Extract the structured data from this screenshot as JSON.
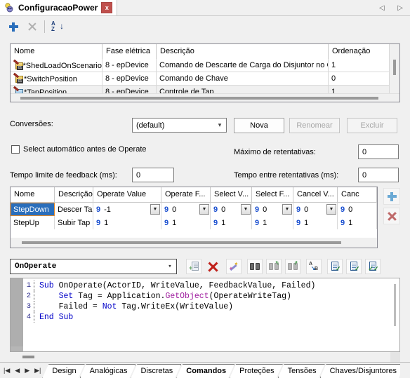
{
  "window": {
    "tab_title": "ConfiguracaoPower",
    "close_label": "x",
    "nav_prev": "◁",
    "nav_next": "▷"
  },
  "toolbar": {
    "add_label": "+",
    "delete_label": "×",
    "sort_a": "A",
    "sort_z": "Z",
    "sort_arrow": "↓"
  },
  "top_grid": {
    "columns": [
      "Nome",
      "Fase elétrica",
      "Descrição",
      "Ordenação"
    ],
    "rows": [
      {
        "icon": "tag-yellow-icon",
        "nome": "*ShedLoadOnScenario",
        "fase": "8 - epDevice",
        "descricao": "Comando de Descarte de Carga do Disjuntor no Ce",
        "ordenacao": "1"
      },
      {
        "icon": "tag-yellow-icon",
        "nome": "*SwitchPosition",
        "fase": "8 - epDevice",
        "descricao": "Comando de Chave",
        "ordenacao": "0"
      },
      {
        "icon": "tag-blue-icon",
        "nome": "*TapPosition",
        "fase": "8 - epDevice",
        "descricao": "Controle de Tap",
        "ordenacao": "1"
      }
    ]
  },
  "conversions": {
    "label": "Conversões:",
    "selected": "(default)",
    "new_button": "Nova",
    "rename_button": "Renomear",
    "delete_button": "Excluir"
  },
  "options": {
    "auto_select_label": "Select automático antes de Operate",
    "auto_select_checked": false,
    "feedback_timeout_label": "Tempo limite de feedback (ms):",
    "feedback_timeout_value": "0",
    "max_retries_label": "Máximo de retentativas:",
    "max_retries_value": "0",
    "retry_interval_label": "Tempo entre retentativas (ms):",
    "retry_interval_value": "0"
  },
  "conv_grid": {
    "columns": [
      "Nome",
      "Descrição",
      "Operate Value",
      "Operate F...",
      "Select V...",
      "Select F...",
      "Cancel V...",
      "Canc"
    ],
    "rows": [
      {
        "nome": "StepDown",
        "descricao": "Descer Tap",
        "operate_value": "-1",
        "operate_f": "0",
        "select_v": "0",
        "select_f": "0",
        "cancel_v": "0",
        "canc": "0",
        "selected": true
      },
      {
        "nome": "StepUp",
        "descricao": "Subir Tap",
        "operate_value": "1",
        "operate_f": "1",
        "select_v": "1",
        "select_f": "1",
        "cancel_v": "1",
        "canc": "1",
        "selected": false
      }
    ],
    "value_marker": "9",
    "add_button": "+",
    "remove_button": "×"
  },
  "script": {
    "selected_event": "OnOperate",
    "toolbar_icons": [
      "new-script-icon",
      "delete-script-icon",
      "wizard-icon",
      "find-icon",
      "find-previous-icon",
      "find-next-icon",
      "replace-icon",
      "check-syntax-icon",
      "compile-icon",
      "compile-all-icon"
    ],
    "code_lines": [
      {
        "n": "1",
        "segments": [
          {
            "t": "Sub",
            "c": "kw"
          },
          {
            "t": " OnOperate(ActorID, WriteValue, FeedbackValue, Failed)",
            "c": ""
          }
        ]
      },
      {
        "n": "2",
        "segments": [
          {
            "t": "    ",
            "c": ""
          },
          {
            "t": "Set",
            "c": "kw"
          },
          {
            "t": " Tag = Application.",
            "c": ""
          },
          {
            "t": "GetObject",
            "c": "mth"
          },
          {
            "t": "(OperateWriteTag)",
            "c": ""
          }
        ]
      },
      {
        "n": "3",
        "segments": [
          {
            "t": "    Failed = ",
            "c": ""
          },
          {
            "t": "Not",
            "c": "kw"
          },
          {
            "t": " Tag.WriteEx(WriteValue)",
            "c": ""
          }
        ]
      },
      {
        "n": "4",
        "segments": [
          {
            "t": "End",
            "c": "kw"
          },
          {
            "t": " ",
            "c": ""
          },
          {
            "t": "Sub",
            "c": "kw"
          }
        ]
      }
    ]
  },
  "bottom": {
    "nav_first": "|◀",
    "nav_prev": "◀",
    "nav_next": "▶",
    "nav_last": "▶|",
    "tabs": [
      {
        "label": "Design",
        "active": false
      },
      {
        "label": "Analógicas",
        "active": false
      },
      {
        "label": "Discretas",
        "active": false
      },
      {
        "label": "Comandos",
        "active": true
      },
      {
        "label": "Proteções",
        "active": false
      },
      {
        "label": "Tensões",
        "active": false
      },
      {
        "label": "Chaves/Disjuntores",
        "active": false
      }
    ]
  },
  "colors": {
    "accent_blue": "#2a6ebb",
    "close_red": "#c0504d",
    "selection_orange": "#e08a2e",
    "value_marker_blue": "#1a4fd0",
    "keyword_blue": "#0000c8",
    "method_purple": "#a020a0"
  }
}
